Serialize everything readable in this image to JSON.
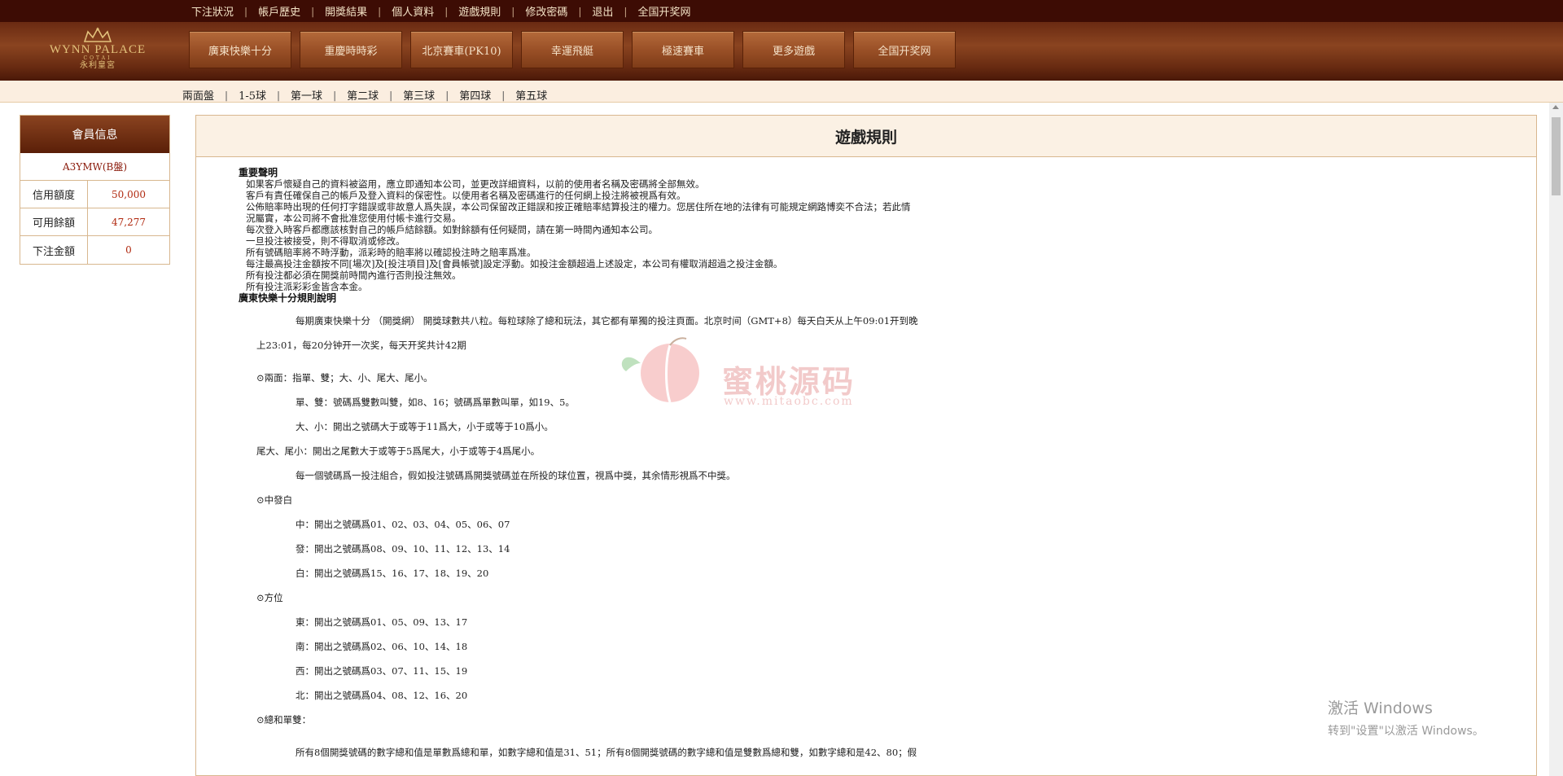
{
  "top_nav": [
    {
      "label": "下注狀況"
    },
    {
      "label": "帳戶歷史"
    },
    {
      "label": "開獎結果"
    },
    {
      "label": "個人資料"
    },
    {
      "label": "遊戲規則"
    },
    {
      "label": "修改密碼"
    },
    {
      "label": "退出"
    },
    {
      "label": "全国开奖网"
    }
  ],
  "logo": {
    "brand": "WYNN PALACE",
    "sub": "COTAI",
    "cn": "永利皇宮"
  },
  "game_tabs": [
    {
      "label": "廣東快樂十分"
    },
    {
      "label": "重慶時時彩"
    },
    {
      "label": "北京賽車(PK10)"
    },
    {
      "label": "幸運飛艇"
    },
    {
      "label": "極速賽車"
    },
    {
      "label": "更多遊戲"
    },
    {
      "label": "全国开奖网"
    }
  ],
  "sub_nav": [
    {
      "label": "兩面盤"
    },
    {
      "label": "1-5球"
    },
    {
      "label": "第一球"
    },
    {
      "label": "第二球"
    },
    {
      "label": "第三球"
    },
    {
      "label": "第四球"
    },
    {
      "label": "第五球"
    }
  ],
  "member": {
    "title": "會員信息",
    "account": "A3YMW(B盤)",
    "rows": [
      {
        "label": "信用額度",
        "value": "50,000"
      },
      {
        "label": "可用餘額",
        "value": "47,277"
      },
      {
        "label": "下注金額",
        "value": "0"
      }
    ]
  },
  "panel": {
    "title": "遊戲規則",
    "declaration_title": "重要聲明",
    "declaration": [
      "如果客戶懷疑自己的資料被盜用，應立即通知本公司，並更改詳細資料，以前的使用者名稱及密碼將全部無效。",
      "客戶有責任確保自己的帳戶及登入資料的保密性。以使用者名稱及密碼進行的任何網上投注將被視爲有效。",
      "公佈賠率時出現的任何打字錯誤或非故意人爲失誤，本公司保留改正錯誤和按正確賠率結算投注的權力。您居住所在地的法律有可能規定網路博奕不合法；若此情",
      "況屬實，本公司將不會批准您使用付帳卡進行交易。",
      "每次登入時客戶都應該核對自己的帳戶結餘額。如對餘額有任何疑問，請在第一時間內通知本公司。",
      "一旦投注被接受，則不得取消或修改。",
      "所有號碼賠率將不時浮動，派彩時的賠率將以確認投注時之賠率爲准。",
      "每注最高投注金額按不同[場次]及[投注項目]及[會員帳號]設定浮動。如投注金額超過上述設定，本公司有權取消超過之投注金額。",
      "所有投注都必須在開獎前時間內進行否則投注無效。",
      "所有投注派彩彩金皆含本金。"
    ],
    "rules_title": "廣東快樂十分規則說明",
    "rules": [
      "每期廣東快樂十分 （開獎網） 開獎球數共八粒。每粒球除了總和玩法，其它都有單獨的投注頁面。北京时间（GMT+8）每天白天从上午09:01开到晚",
      "上23:01，每20分钟开一次奖，每天开奖共计42期",
      "⊙兩面：指單、雙；大、小、尾大、尾小。",
      "單、雙：號碼爲雙數叫雙，如8、16；號碼爲單數叫單，如19、5。",
      "大、小：開出之號碼大于或等于11爲大，小于或等于10爲小。",
      "尾大、尾小：開出之尾數大于或等于5爲尾大，小于或等于4爲尾小。",
      "每一個號碼爲一投注組合，假如投注號碼爲開獎號碼並在所投的球位置，視爲中獎，其余情形視爲不中獎。",
      "⊙中發白",
      "中：開出之號碼爲01、02、03、04、05、06、07",
      "發：開出之號碼爲08、09、10、11、12、13、14",
      "白：開出之號碼爲15、16、17、18、19、20",
      "⊙方位",
      "東：開出之號碼爲01、05、09、13、17",
      "南：開出之號碼爲02、06、10、14、18",
      "西：開出之號碼爲03、07、11、15、19",
      "北：開出之號碼爲04、08、12、16、20",
      "⊙總和單雙：",
      "所有8個開獎號碼的數字總和值是單數爲總和單，如數字總和值是31、51；所有8個開獎號碼的數字總和值是雙數爲總和雙，如數字總和是42、80；假"
    ]
  },
  "watermark": {
    "text": "蜜桃源码",
    "url": "www.mitaobc.com"
  },
  "windows_activation": {
    "line1": "激活 Windows",
    "line2": "转到\"设置\"以激活 Windows。"
  },
  "colors": {
    "topbar": "#3d0c04",
    "header": "#7a3a1a",
    "tab": "#9a5027",
    "accent_red": "#b0280e",
    "border": "#d8b78f"
  }
}
